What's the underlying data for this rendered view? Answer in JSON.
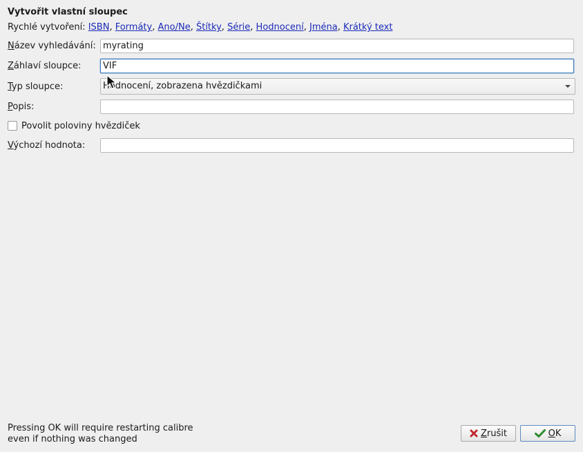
{
  "dialog": {
    "title": "Vytvořit vlastní sloupec"
  },
  "quick_create": {
    "label": "Rychlé vytvoření:",
    "links": [
      "ISBN",
      "Formáty",
      "Ano/Ne",
      "Štítky",
      "Série",
      "Hodnocení",
      "Jména",
      "Krátký text"
    ]
  },
  "fields": {
    "lookup_name": {
      "label_mnemonic": "N",
      "label_rest": "ázev vyhledávání:",
      "value": "myrating"
    },
    "column_heading": {
      "label_mnemonic": "Z",
      "label_rest": "áhlaví sloupce:",
      "value": "VIF"
    },
    "column_type": {
      "label_mnemonic": "T",
      "label_rest": "yp sloupce:",
      "value": "Hodnocení, zobrazena hvězdičkami"
    },
    "description": {
      "label_mnemonic": "P",
      "label_rest": "opis:",
      "value": ""
    },
    "half_stars": {
      "label": "Povolit poloviny hvězdiček",
      "checked": false
    },
    "default_value": {
      "label_mnemonic": "V",
      "label_rest": "ýchozí hodnota:",
      "value": ""
    }
  },
  "footer": {
    "note_line1": "Pressing OK will require restarting calibre",
    "note_line2": "even if nothing was changed",
    "cancel_mnemonic": "Z",
    "cancel_rest": "rušit",
    "ok_mnemonic": "O",
    "ok_rest": "K"
  },
  "colors": {
    "link": "#1a2ab8",
    "cancel_icon": "#c0272d",
    "ok_icon": "#2e8b2e",
    "focus_border": "#3a76b5"
  },
  "icons": {
    "cancel": "x-icon",
    "ok": "checkmark-icon",
    "select": "chevron-down-icon",
    "pointer": "mouse-cursor-icon"
  }
}
